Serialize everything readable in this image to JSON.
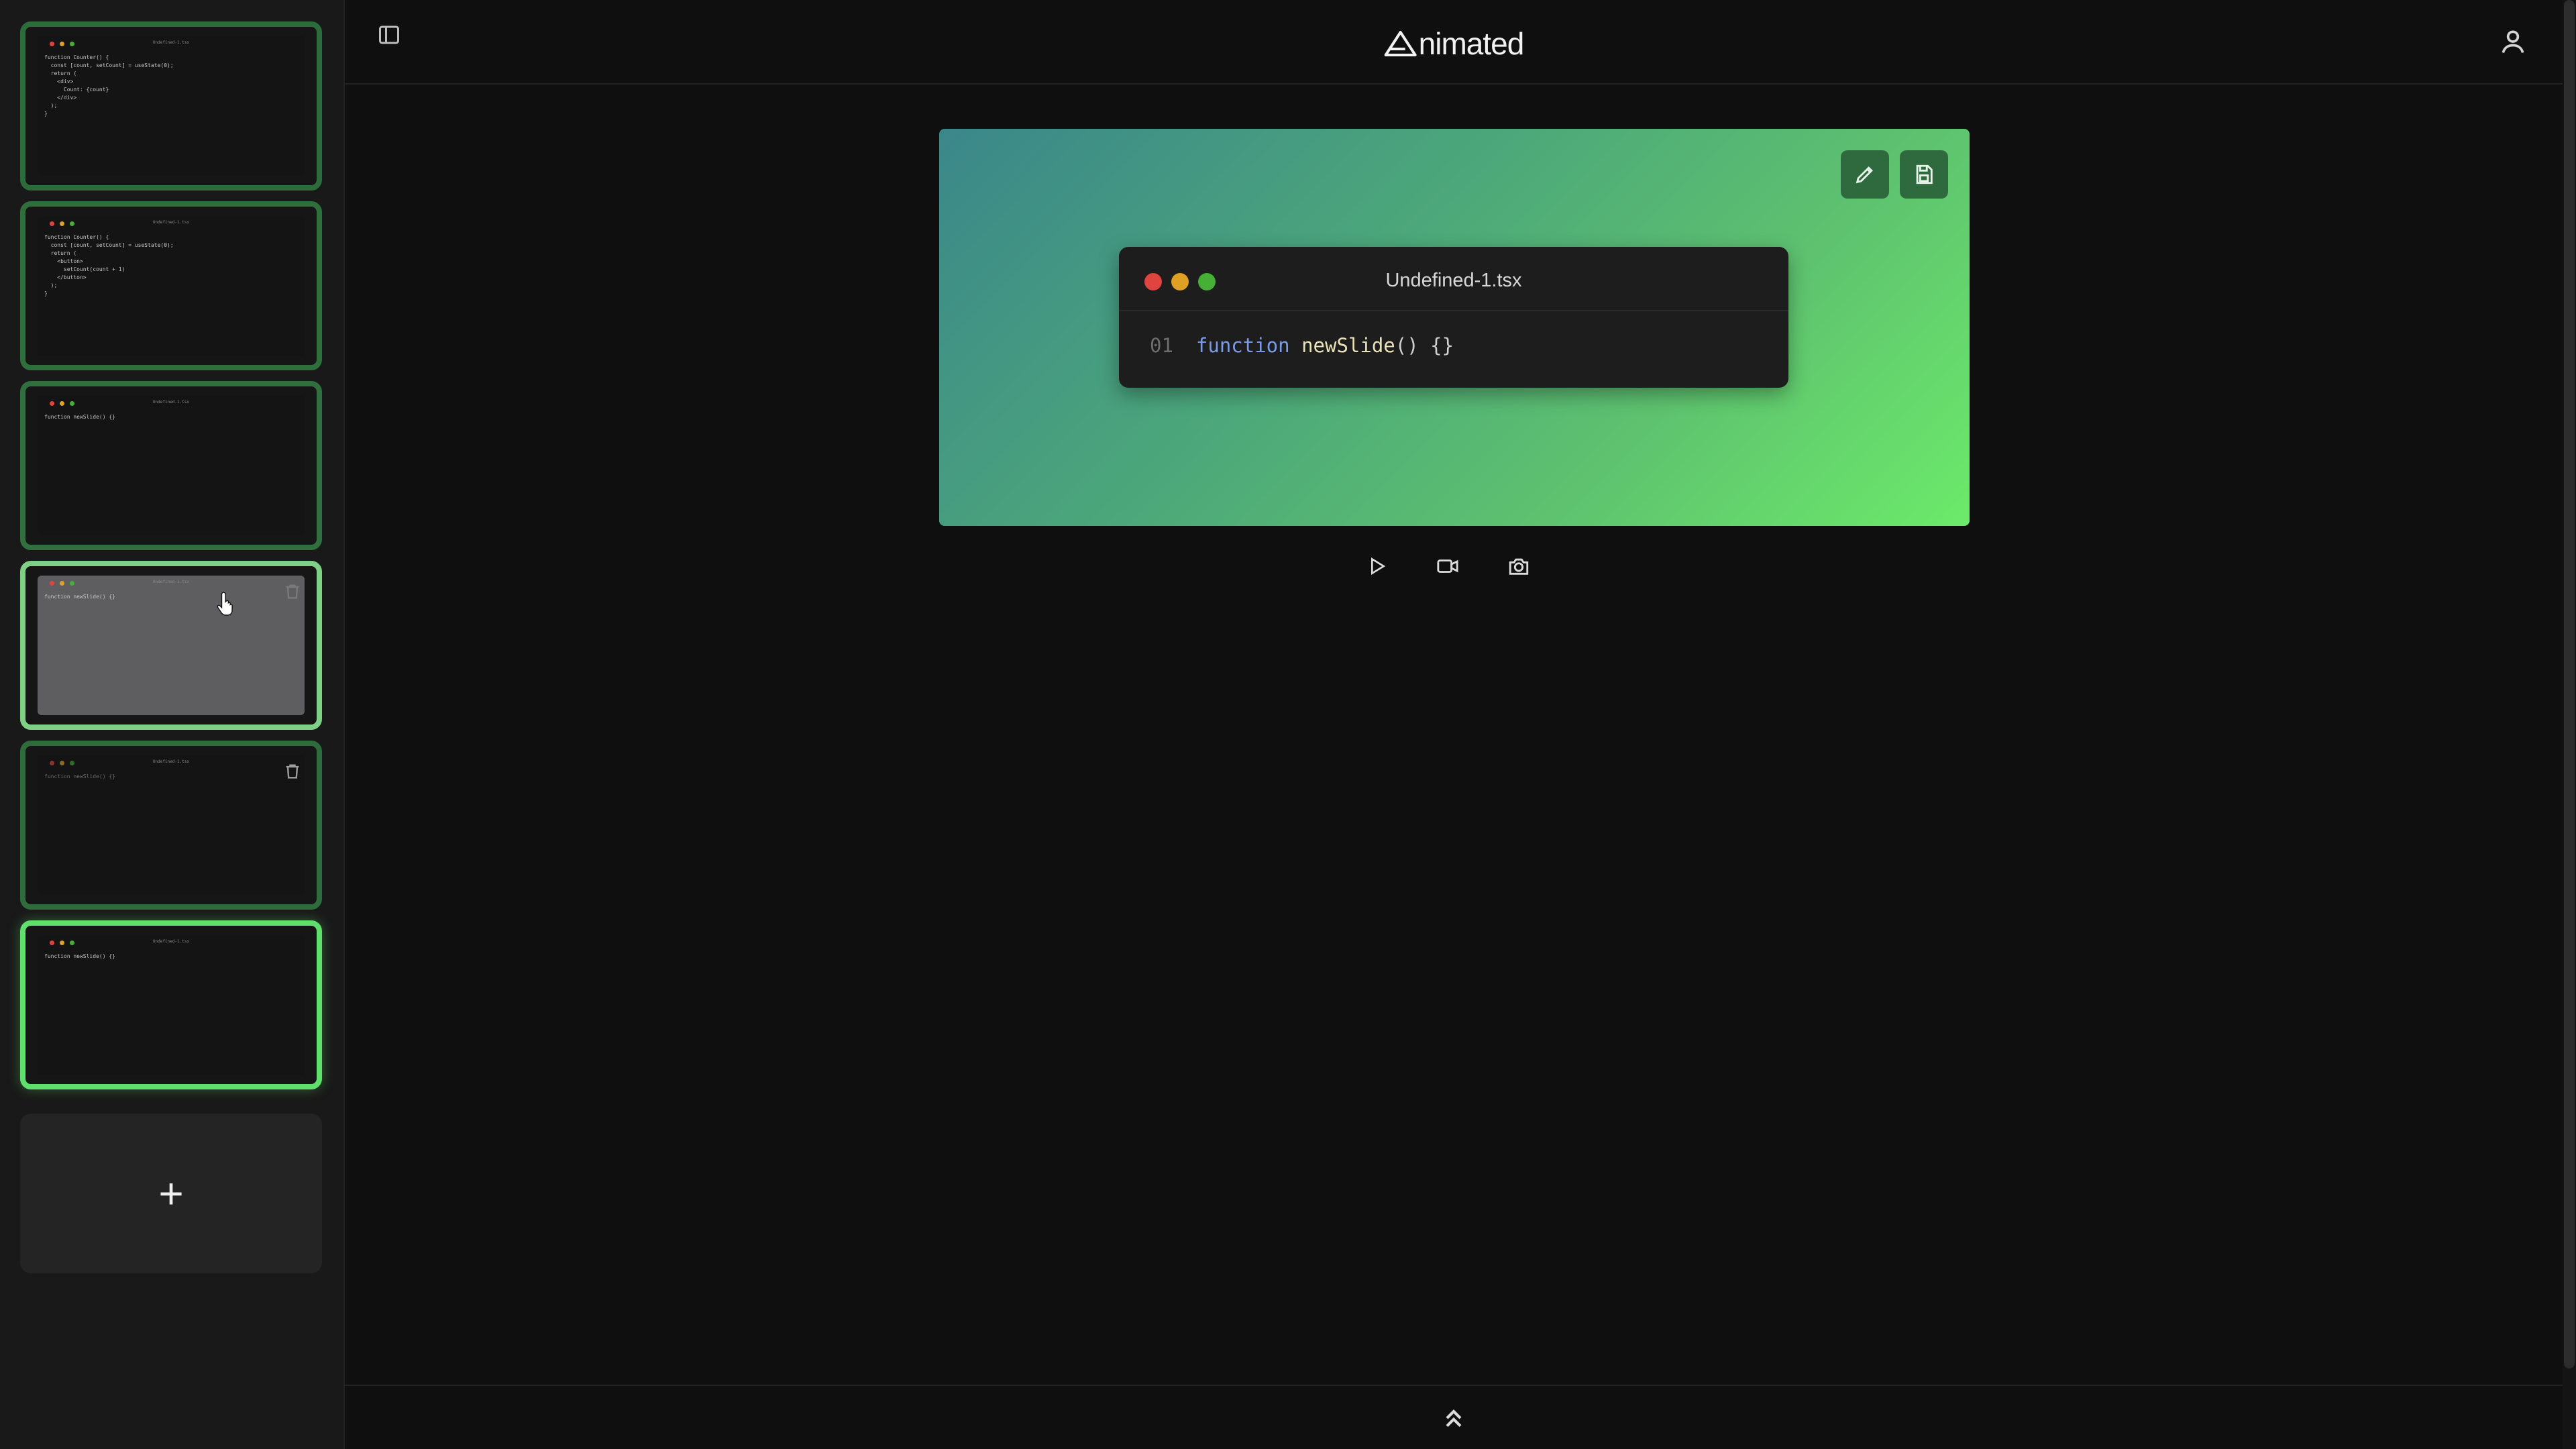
{
  "app": {
    "logo_text": "nimated"
  },
  "colors": {
    "accent_green": "#6cea6a",
    "accent_teal": "#3b878a",
    "dot_red": "#e0443e",
    "dot_yellow": "#dea123",
    "dot_green": "#45b035"
  },
  "sidebar": {
    "slides": [
      {
        "title": "Undefined-1.tsx",
        "code": [
          "function Counter() {",
          "  const [count, setCount] = useState(0);",
          "  return (",
          "    <div>",
          "      Count: {count}",
          "    </div>",
          "  );",
          "}"
        ]
      },
      {
        "title": "Undefined-1.tsx",
        "code": [
          "function Counter() {",
          "  const [count, setCount] = useState(0);",
          "  return (",
          "    <button>",
          "      setCount(count + 1)",
          "    </button>",
          "  );",
          "}"
        ]
      },
      {
        "title": "Undefined-1.tsx",
        "code": [
          "function newSlide() {}"
        ]
      },
      {
        "title": "Undefined-1.tsx",
        "code": [
          "function newSlide() {}"
        ]
      },
      {
        "title": "Undefined-1.tsx",
        "code": [
          "function newSlide() {}"
        ]
      },
      {
        "title": "Undefined-1.tsx",
        "code": [
          "function newSlide() {}"
        ]
      }
    ],
    "add_label": "+"
  },
  "editor": {
    "file_name": "Undefined-1.tsx",
    "line_number": "01",
    "code_keyword": "function",
    "code_name": "newSlide",
    "code_rest": "() {}"
  }
}
